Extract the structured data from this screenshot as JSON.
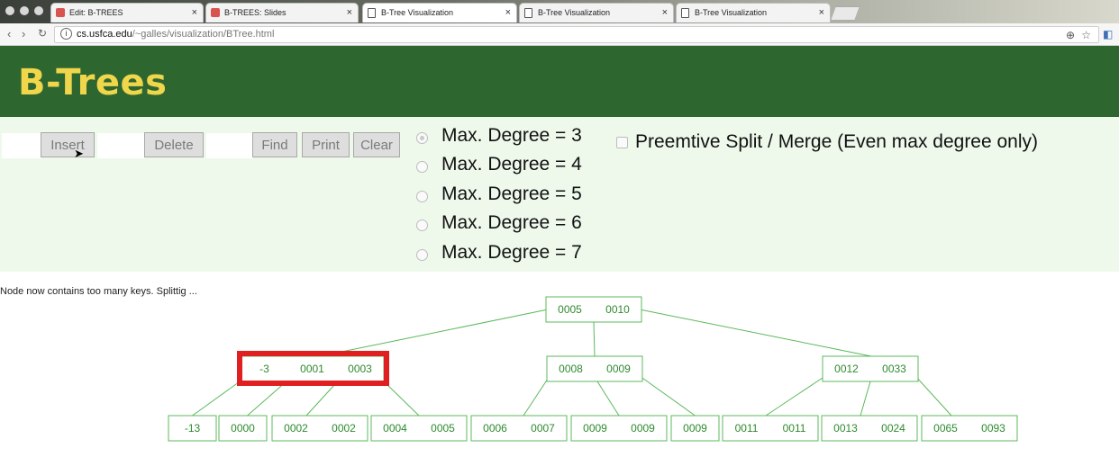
{
  "browser": {
    "tabs": [
      {
        "title": "Edit: B-TREES",
        "icon": "red-square-icon"
      },
      {
        "title": "B-TREES: Slides",
        "icon": "red-square-icon"
      },
      {
        "title": "B-Tree Visualization",
        "icon": "document-icon"
      },
      {
        "title": "B-Tree Visualization",
        "icon": "document-icon"
      },
      {
        "title": "B-Tree Visualization",
        "icon": "document-icon"
      }
    ],
    "url_host": "cs.usfca.edu",
    "url_path": "/~galles/visualization/BTree.html"
  },
  "header": {
    "title": "B-Trees"
  },
  "controls": {
    "insert_label": "Insert",
    "delete_label": "Delete",
    "find_label": "Find",
    "print_label": "Print",
    "clear_label": "Clear",
    "degree_options": [
      "Max. Degree = 3",
      "Max. Degree = 4",
      "Max. Degree = 5",
      "Max. Degree = 6",
      "Max. Degree = 7"
    ],
    "selected_degree_index": 0,
    "preemptive_label": "Preemtive Split / Merge (Even max degree only)",
    "preemptive_checked": false
  },
  "status": {
    "message": "Node now contains too many keys.  Splittig ..."
  },
  "tree": {
    "root": [
      "0005",
      "0010"
    ],
    "level1": [
      [
        "-3",
        "0001",
        "0003"
      ],
      [
        "0008",
        "0009"
      ],
      [
        "0012",
        "0033"
      ]
    ],
    "highlighted_node": 0,
    "leaves": [
      [
        "-13"
      ],
      [
        "0000"
      ],
      [
        "0002",
        "0002"
      ],
      [
        "0004",
        "0005"
      ],
      [
        "0006",
        "0007"
      ],
      [
        "0009",
        "0009"
      ],
      [
        "0009"
      ],
      [
        "0011",
        "0011"
      ],
      [
        "0013",
        "0024"
      ],
      [
        "0065",
        "0093"
      ]
    ]
  },
  "colors": {
    "header_bg": "#2e6630",
    "title": "#f0d64a",
    "panel_bg": "#eef9ec",
    "node_stroke": "#5cb85c",
    "node_text": "#2e8a2e",
    "highlight": "#e02020"
  }
}
